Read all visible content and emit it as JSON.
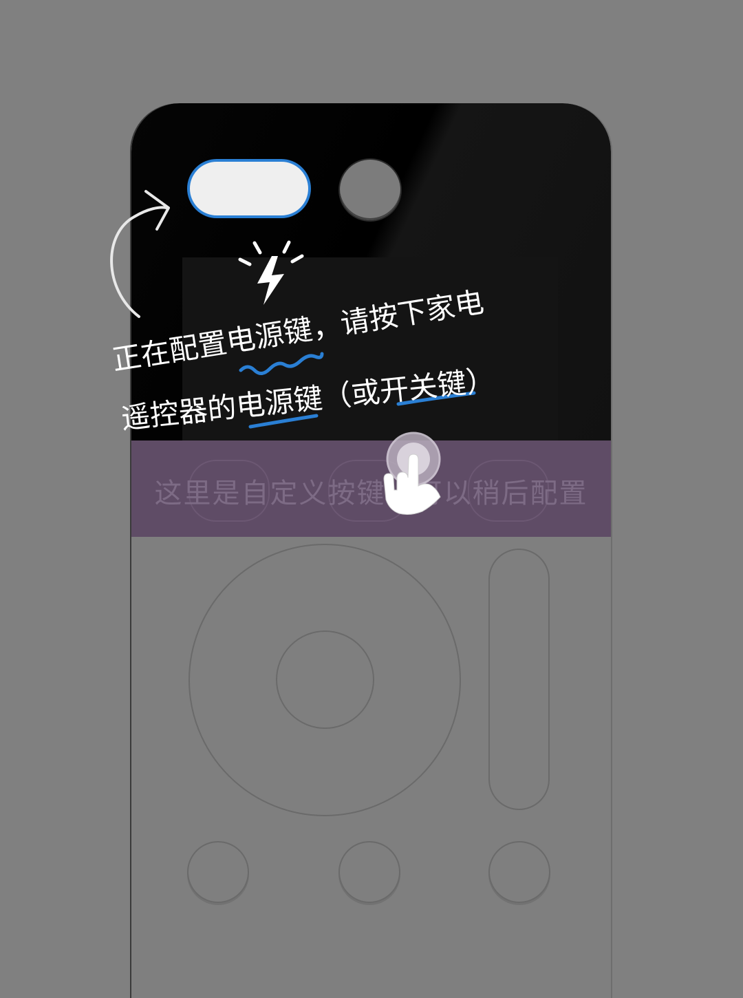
{
  "guide": {
    "line1": "正在配置电源键，请按下家电",
    "line2": "遥控器的电源键（或开关键）"
  },
  "custom_area": {
    "label": "这里是自定义按键，可以稍后配置"
  },
  "colors": {
    "background": "#808080",
    "remote_top": "#000000",
    "accent_blue": "#2a7fd4",
    "custom_strip": "#5f4c66"
  },
  "icons": [
    "curved-arrow-icon",
    "flash-icon",
    "tap-hand-icon",
    "squiggle-underline-icon",
    "underline-icon"
  ]
}
